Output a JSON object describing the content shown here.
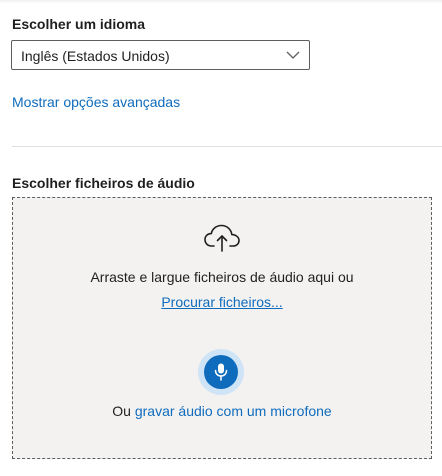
{
  "language": {
    "label": "Escolher um idioma",
    "selected": "Inglês (Estados Unidos)",
    "advanced_link": "Mostrar opções avançadas"
  },
  "audio": {
    "label": "Escolher ficheiros de áudio",
    "drop_text": "Arraste e largue ficheiros de áudio aqui ou",
    "browse_link": "Procurar ficheiros...",
    "record_prefix": "Ou",
    "record_link": "gravar áudio com um microfone"
  },
  "icons": {
    "language_select": "chevron-down-icon",
    "upload": "cloud-upload-icon",
    "microphone": "microphone-icon"
  },
  "colors": {
    "accent": "#0f6cbd",
    "dropzone_bg": "#f3f2f1",
    "mic_halo": "#cfe4f6"
  }
}
